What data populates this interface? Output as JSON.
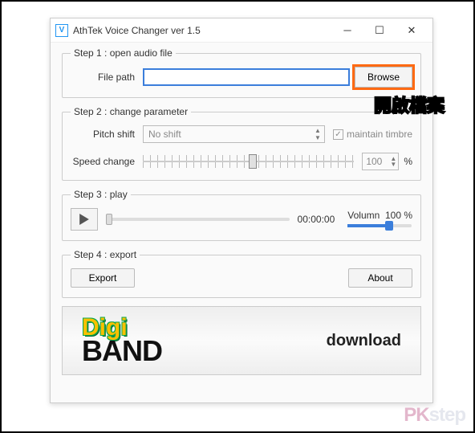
{
  "window": {
    "title": "AthTek Voice Changer ver 1.5",
    "icon_letter": "V"
  },
  "step1": {
    "legend": "Step 1 : open audio file",
    "file_path_label": "File path",
    "file_path_value": "",
    "browse_label": "Browse"
  },
  "annotation": "開啟檔案",
  "step2": {
    "legend": "Step 2 : change parameter",
    "pitch_label": "Pitch shift",
    "pitch_value": "No shift",
    "maintain_label": "maintain timbre",
    "maintain_checked": true,
    "speed_label": "Speed change",
    "speed_value": "100",
    "speed_unit": "%",
    "speed_slider_percent": 50
  },
  "step3": {
    "legend": "Step 3 : play",
    "time": "00:00:00",
    "progress_percent": 0,
    "volume_label": "Volumn",
    "volume_value": "100 %",
    "volume_percent": 65
  },
  "step4": {
    "legend": "Step 4 : export",
    "export_label": "Export",
    "about_label": "About"
  },
  "banner": {
    "logo_top": "Digi",
    "logo_bottom": "BAND",
    "download_label": "download"
  },
  "watermark": {
    "p1": "PK",
    "p2": "step"
  }
}
